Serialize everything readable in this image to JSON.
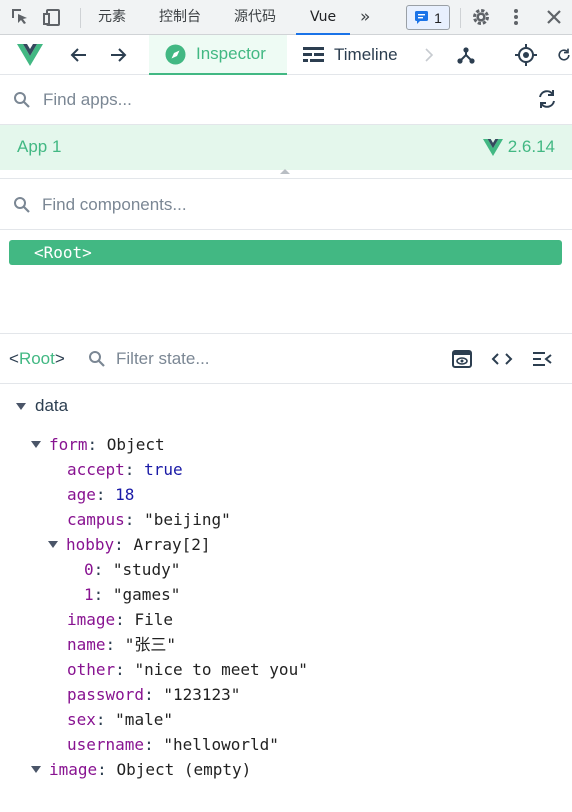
{
  "devtools": {
    "tabs": [
      "元素",
      "控制台",
      "源代码",
      "Vue"
    ],
    "active_tab": "Vue",
    "more_symbol": "»",
    "issues_count": "1"
  },
  "vue_toolbar": {
    "tabs": [
      {
        "label": "Inspector",
        "icon": "compass-icon",
        "active": true
      },
      {
        "label": "Timeline",
        "icon": "timeline-icon",
        "active": false
      }
    ]
  },
  "find_apps": {
    "placeholder": "Find apps..."
  },
  "app": {
    "name": "App 1",
    "version": "2.6.14"
  },
  "find_components": {
    "placeholder": "Find components..."
  },
  "component_tree": {
    "root": "<Root>"
  },
  "state": {
    "component_name": "Root",
    "filter_placeholder": "Filter state...",
    "section": "data",
    "rows": [
      {
        "key": "form",
        "sep": ": ",
        "value": "Object",
        "vtype": "type",
        "indent": 0,
        "expandable": true
      },
      {
        "key": "accept",
        "sep": ": ",
        "value": "true",
        "vtype": "bool",
        "indent": 1
      },
      {
        "key": "age",
        "sep": ": ",
        "value": "18",
        "vtype": "num",
        "indent": 1
      },
      {
        "key": "campus",
        "sep": ": ",
        "value": "\"beijing\"",
        "vtype": "str",
        "indent": 1
      },
      {
        "key": "hobby",
        "sep": ": ",
        "value": "Array[2]",
        "vtype": "type",
        "indent": 0.5,
        "expandable": true
      },
      {
        "key": "0",
        "sep": ": ",
        "value": "\"study\"",
        "vtype": "str",
        "indent": 2
      },
      {
        "key": "1",
        "sep": ": ",
        "value": "\"games\"",
        "vtype": "str",
        "indent": 2
      },
      {
        "key": "image",
        "sep": ": ",
        "value": "File",
        "vtype": "type",
        "indent": 1
      },
      {
        "key": "name",
        "sep": ": ",
        "value": "\"张三\"",
        "vtype": "str",
        "indent": 1
      },
      {
        "key": "other",
        "sep": ": ",
        "value": "\"nice to meet you\"",
        "vtype": "str",
        "indent": 1
      },
      {
        "key": "password",
        "sep": ": ",
        "value": "\"123123\"",
        "vtype": "str",
        "indent": 1
      },
      {
        "key": "sex",
        "sep": ": ",
        "value": "\"male\"",
        "vtype": "str",
        "indent": 1
      },
      {
        "key": "username",
        "sep": ": ",
        "value": "\"helloworld\"",
        "vtype": "str",
        "indent": 1
      },
      {
        "key": "image",
        "sep": ": ",
        "value": "Object (empty)",
        "vtype": "type",
        "indent": 0,
        "expandable": true
      }
    ]
  },
  "colors": {
    "accent": "#42b883",
    "key": "#881391",
    "literal": "#1a1aa6",
    "active_devtools_tab": "#1a73e8"
  }
}
